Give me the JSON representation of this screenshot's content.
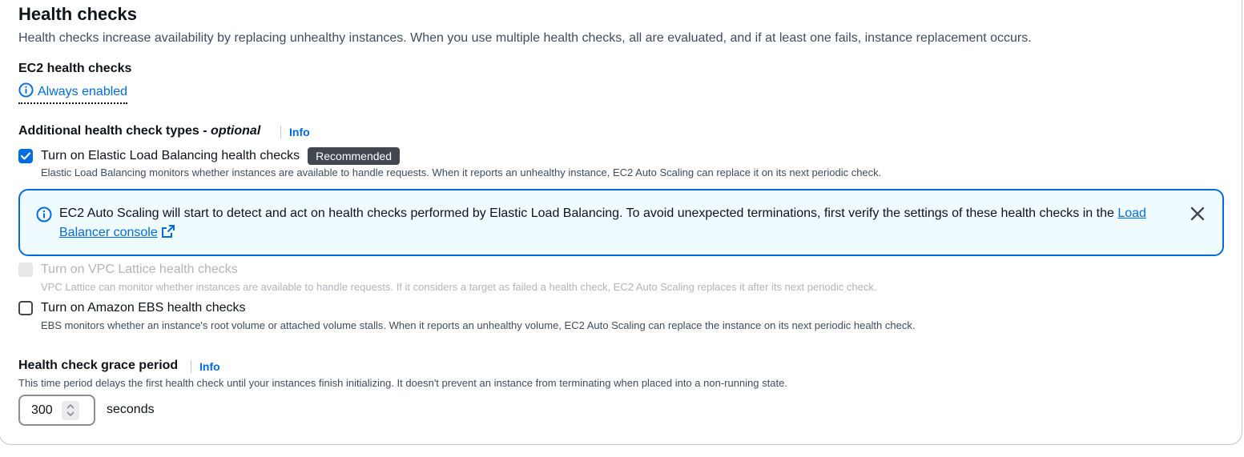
{
  "section": {
    "title": "Health checks",
    "description": "Health checks increase availability by replacing unhealthy instances. When you use multiple health checks, all are evaluated, and if at least one fails, instance replacement occurs."
  },
  "ec2": {
    "label": "EC2 health checks",
    "status": "Always enabled",
    "status_icon": "info-icon"
  },
  "additional": {
    "label": "Additional health check types - ",
    "label_optional": "optional",
    "info_link": "Info",
    "options": [
      {
        "label": "Turn on Elastic Load Balancing health checks",
        "checked": true,
        "disabled": false,
        "badge": "Recommended",
        "description": "Elastic Load Balancing monitors whether instances are available to handle requests. When it reports an unhealthy instance, EC2 Auto Scaling can replace it on its next periodic check."
      },
      {
        "label": "Turn on VPC Lattice health checks",
        "checked": false,
        "disabled": true,
        "description": "VPC Lattice can monitor whether instances are available to handle requests. If it considers a target as failed a health check, EC2 Auto Scaling replaces it after its next periodic check."
      },
      {
        "label": "Turn on Amazon EBS health checks",
        "checked": false,
        "disabled": false,
        "description": "EBS monitors whether an instance's root volume or attached volume stalls. When it reports an unhealthy volume, EC2 Auto Scaling can replace the instance on its next periodic health check."
      }
    ]
  },
  "alert": {
    "text": "EC2 Auto Scaling will start to detect and act on health checks performed by Elastic Load Balancing. To avoid unexpected terminations, first verify the settings of these health checks in the ",
    "link_text": "Load Balancer console",
    "icon": "info-icon",
    "close_icon": "close-icon",
    "external_icon": "external-link-icon"
  },
  "grace": {
    "label": "Health check grace period",
    "info_link": "Info",
    "description": "This time period delays the first health check until your instances finish initializing. It doesn't prevent an instance from terminating when placed into a non-running state.",
    "value": "300",
    "unit": "seconds"
  },
  "colors": {
    "link": "#006ce0",
    "alert_bg": "#f0fbff",
    "badge_bg": "#424650"
  }
}
